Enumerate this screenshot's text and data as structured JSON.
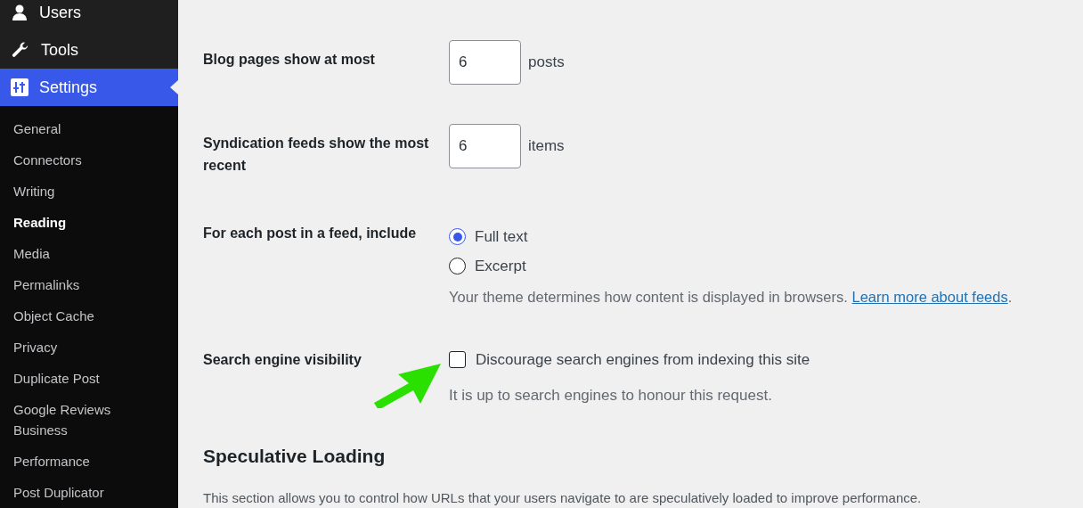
{
  "menu": [
    {
      "label": "Users",
      "selected": false
    },
    {
      "label": "Tools",
      "selected": false
    },
    {
      "label": "Settings",
      "selected": true
    }
  ],
  "submenu": [
    {
      "label": "General",
      "selected": false
    },
    {
      "label": "Connectors",
      "selected": false
    },
    {
      "label": "Writing",
      "selected": false
    },
    {
      "label": "Reading",
      "selected": true
    },
    {
      "label": "Media",
      "selected": false
    },
    {
      "label": "Permalinks",
      "selected": false
    },
    {
      "label": "Object Cache",
      "selected": false
    },
    {
      "label": "Privacy",
      "selected": false
    },
    {
      "label": "Duplicate Post",
      "selected": false
    },
    {
      "label": "Google Reviews Business",
      "selected": false
    },
    {
      "label": "Performance",
      "selected": false
    },
    {
      "label": "Post Duplicator",
      "selected": false
    }
  ],
  "settings": [
    {
      "kind": "number",
      "label": "Blog pages show at most",
      "value": "6",
      "unit": "posts"
    },
    {
      "kind": "number",
      "label": "Syndication feeds show the most recent",
      "value": "6",
      "unit": "items"
    },
    {
      "kind": "radio",
      "label": "For each post in a feed, include",
      "options": [
        {
          "label": "Full text",
          "selected": true
        },
        {
          "label": "Excerpt",
          "selected": false
        }
      ],
      "description": "Your theme determines how content is displayed in browsers.",
      "link": "Learn more about feeds",
      "after_link": "."
    },
    {
      "kind": "checkbox",
      "label": "Search engine visibility",
      "option": "Discourage search engines from indexing this site",
      "checked": false,
      "note": "It is up to search engines to honour this request.",
      "annotated": true
    }
  ],
  "section": {
    "title": "Speculative Loading",
    "text": "This section allows you to control how URLs that your users navigate to are speculatively loaded to improve performance."
  }
}
